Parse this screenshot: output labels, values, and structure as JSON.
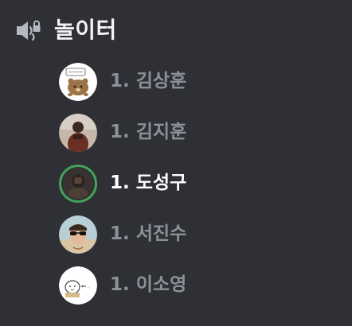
{
  "channel": {
    "name": "놀이터",
    "icon": "speaker-lock-icon"
  },
  "users": [
    {
      "label": "1. 김상훈",
      "avatar": "bear-avatar",
      "speaking": false
    },
    {
      "label": "1. 김지훈",
      "avatar": "person-avatar",
      "speaking": false
    },
    {
      "label": "1. 도성구",
      "avatar": "person-avatar",
      "speaking": true
    },
    {
      "label": "1. 서진수",
      "avatar": "sunglasses-avatar",
      "speaking": false
    },
    {
      "label": "1. 이소영",
      "avatar": "doodle-avatar",
      "speaking": false
    }
  ],
  "colors": {
    "background": "#2e3035",
    "muted_text": "#8e9097",
    "active_text": "#ffffff",
    "speaking_ring": "#43a25a"
  }
}
